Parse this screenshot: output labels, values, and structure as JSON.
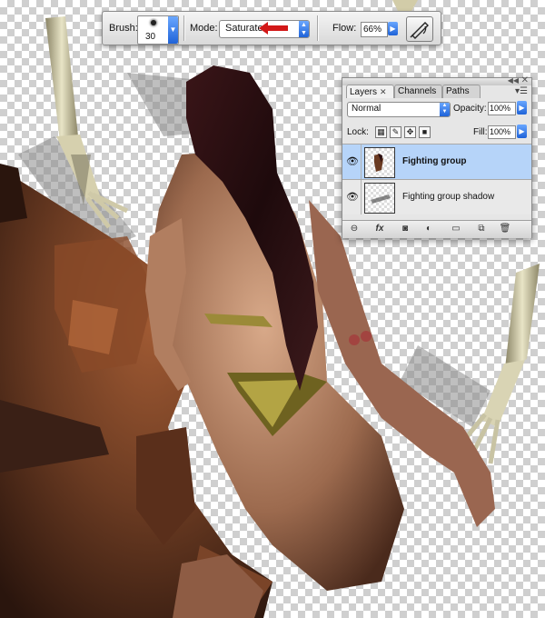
{
  "options_bar": {
    "brush_label": "Brush:",
    "brush_size": "30",
    "mode_label": "Mode:",
    "mode_value": "Saturate",
    "flow_label": "Flow:",
    "flow_value": "66%"
  },
  "layers_panel": {
    "tabs": [
      {
        "label": "Layers",
        "active": true
      },
      {
        "label": "Channels",
        "active": false
      },
      {
        "label": "Paths",
        "active": false
      }
    ],
    "blend_mode": "Normal",
    "opacity_label": "Opacity:",
    "opacity_value": "100%",
    "lock_label": "Lock:",
    "fill_label": "Fill:",
    "fill_value": "100%",
    "layers": [
      {
        "name": "Fighting group",
        "selected": true,
        "visible": true
      },
      {
        "name": "Fighting group shadow",
        "selected": false,
        "visible": true
      }
    ]
  },
  "colors": {
    "selection_blue": "#b6d4f9",
    "arrow_red": "#d21818",
    "skin_brown": "#6b3b22",
    "hair": "#2a0e10"
  }
}
